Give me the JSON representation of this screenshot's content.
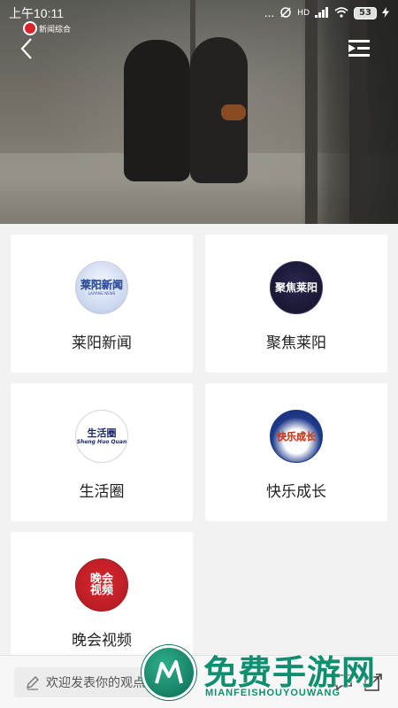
{
  "status_bar": {
    "time": "上午10:11",
    "signal_dots": "...",
    "hd_label": "HD",
    "battery": "53"
  },
  "player": {
    "channel_name": "新闻综合"
  },
  "channels": [
    {
      "label": "莱阳新闻",
      "logo_text_1": "莱阳新闻",
      "logo_text_2": "LAIYANG NEWS"
    },
    {
      "label": "聚焦莱阳",
      "logo_text_1": "聚焦莱阳",
      "logo_text_2": ""
    },
    {
      "label": "生活圈",
      "logo_text_1": "生活圈",
      "logo_text_2": "Sheng Huo Quan"
    },
    {
      "label": "快乐成长",
      "logo_text_1": "快乐成长",
      "logo_text_2": ""
    },
    {
      "label": "晚会视频",
      "logo_text_1": "晚会",
      "logo_text_2": "视频"
    }
  ],
  "comment_bar": {
    "placeholder": "欢迎发表你的观点"
  },
  "watermark": {
    "title": "免费手游网",
    "subtitle": "MIANFEISHOUYOUWANG"
  },
  "colors": {
    "background": "#f2f2f2",
    "card": "#ffffff",
    "watermark_green": "#0f8f6f",
    "red_logo": "#c8202a",
    "navy_logo": "#1e1c3a"
  }
}
